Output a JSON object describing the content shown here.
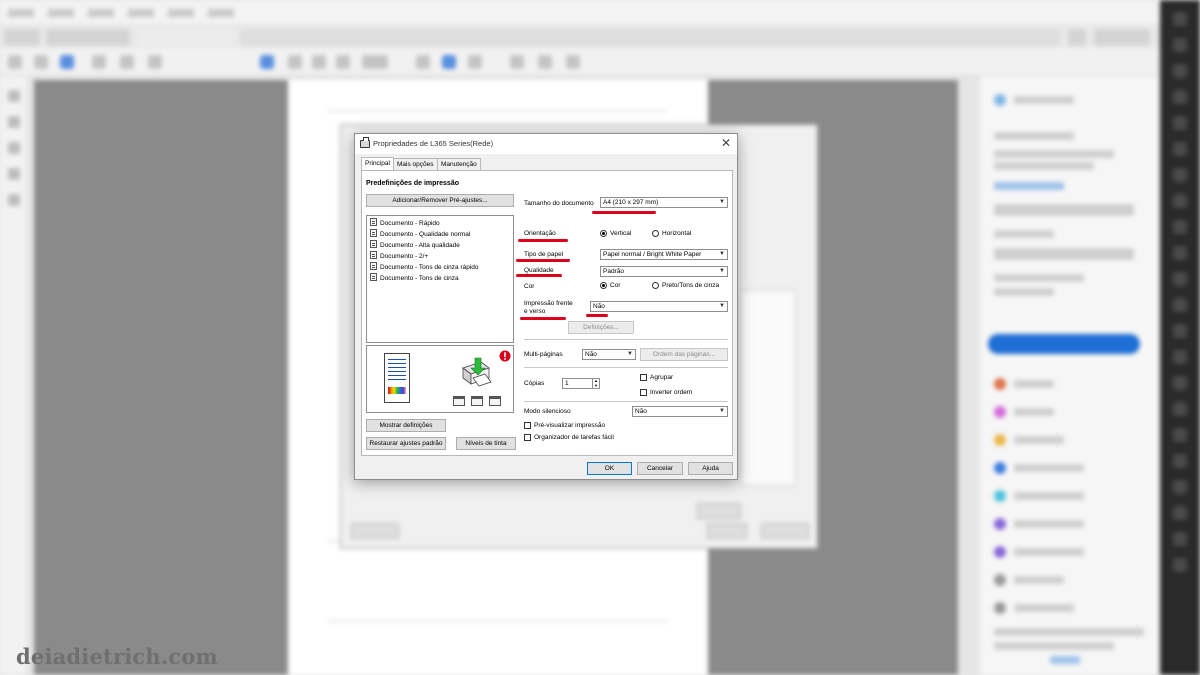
{
  "dialog": {
    "title": "Propriedades de L365 Series(Rede)",
    "close_label": "✕",
    "tabs": [
      {
        "label": "Principal",
        "active": true
      },
      {
        "label": "Mais opções",
        "active": false
      },
      {
        "label": "Manutenção",
        "active": false
      }
    ]
  },
  "presets": {
    "heading": "Predefinições de impressão",
    "add_remove_label": "Adicionar/Remover Pré-ajustes...",
    "items": [
      "Documento - Rápido",
      "Documento - Qualidade normal",
      "Documento - Alta qualidade",
      "Documento - 2/+",
      "Documento - Tons de cinza rápido",
      "Documento - Tons de cinza"
    ]
  },
  "left_buttons": {
    "show_settings": "Mostrar definições",
    "restore_defaults": "Restaurar ajustes padrão",
    "ink_levels": "Níveis de tinta"
  },
  "settings": {
    "document_size_label": "Tamanho do documento",
    "document_size_value": "A4 (210 x 297 mm)",
    "orientation_label": "Orientação",
    "orientation_options": [
      "Vertical",
      "Horizontal"
    ],
    "orientation_selected": "Vertical",
    "paper_type_label": "Tipo de papel",
    "paper_type_value": "Papel normal / Bright White Paper",
    "quality_label": "Qualidade",
    "quality_value": "Padrão",
    "color_label": "Cor",
    "color_options": [
      "Cor",
      "Preto/Tons de cinza"
    ],
    "color_selected": "Cor",
    "duplex_label_line1": "Impressão frente",
    "duplex_label_line2": "e verso",
    "duplex_value": "Não",
    "duplex_settings_button": "Definições...",
    "multipage_label": "Multi-páginas",
    "multipage_value": "Não",
    "page_order_button": "Ordem das páginas...",
    "copies_label": "Cópias",
    "copies_value": "1",
    "collate_label": "Agrupar",
    "reverse_order_label": "Inverter ordem",
    "quiet_mode_label": "Modo silencioso",
    "quiet_mode_value": "Não",
    "preview_print_label": "Pré-visualizar impressão",
    "job_arranger_label": "Organizador de tarefas fácil"
  },
  "footer": {
    "ok": "OK",
    "cancel": "Cancelar",
    "help": "Ajuda"
  },
  "watermark": "deiadietrich.com",
  "colors": {
    "annotation_underline": "#e0001b",
    "accent": "#0078d7"
  },
  "icons": [
    "printer-icon",
    "close-icon",
    "chevron-down-icon",
    "document-icon",
    "alert-icon"
  ]
}
